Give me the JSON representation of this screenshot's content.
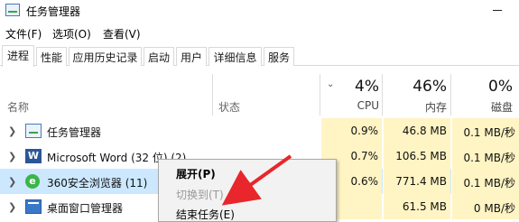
{
  "window": {
    "title": "任务管理器"
  },
  "menu": [
    "文件(F)",
    "选项(O)",
    "查看(V)"
  ],
  "tabs": [
    "进程",
    "性能",
    "应用历史记录",
    "启动",
    "用户",
    "详细信息",
    "服务"
  ],
  "header": {
    "name_label": "名称",
    "status_label": "状态",
    "cpu_pct": "4%",
    "cpu_label": "CPU",
    "mem_pct": "46%",
    "mem_label": "内存",
    "disk_pct": "0%",
    "disk_label": "磁盘"
  },
  "processes": [
    {
      "name": "任务管理器",
      "icon": "task-manager-icon",
      "cpu": "0.9%",
      "mem": "46.8 MB",
      "disk": "0.1 MB/秒"
    },
    {
      "name": "Microsoft Word (32 位) (2)",
      "icon": "word-icon",
      "cpu": "0.7%",
      "mem": "106.5 MB",
      "disk": "0.1 MB/秒"
    },
    {
      "name": "360安全浏览器 (11)",
      "icon": "360-browser-icon",
      "cpu": "0.6%",
      "mem": "771.4 MB",
      "disk": "0.1 MB/秒"
    },
    {
      "name": "桌面窗口管理器",
      "icon": "desktop-window-manager-icon",
      "cpu": "",
      "mem": "61.5 MB",
      "disk": "0 MB/秒"
    }
  ],
  "context_menu": {
    "items": [
      {
        "label": "展开(P)",
        "state": "bold"
      },
      {
        "label": "切换到(T)",
        "state": "disabled"
      },
      {
        "label": "结束任务(E)",
        "state": "normal"
      }
    ]
  },
  "colors": {
    "column_highlight": "#fff4c4",
    "selected_row": "#cce8ff",
    "annotation_arrow": "#e8262b"
  }
}
